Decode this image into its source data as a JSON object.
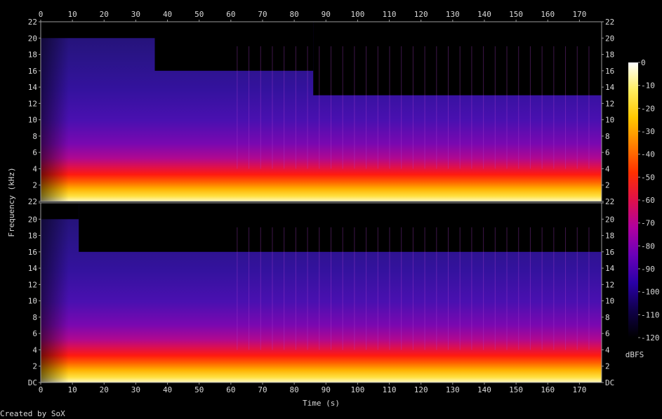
{
  "chart_data": {
    "type": "heatmap",
    "title": "",
    "xlabel": "Time (s)",
    "ylabel": "Frequency (kHz)",
    "xlim": [
      0,
      177
    ],
    "ylim": [
      0,
      22
    ],
    "x_ticks": [
      0,
      10,
      20,
      30,
      40,
      50,
      60,
      70,
      80,
      90,
      100,
      110,
      120,
      130,
      140,
      150,
      160,
      170
    ],
    "x_tick_labels": [
      "0",
      "10",
      "20",
      "30",
      "40",
      "50",
      "60",
      "70",
      "80",
      "90",
      "100",
      "110",
      "120",
      "130",
      "140",
      "150",
      "160",
      "170"
    ],
    "channels": [
      {
        "y_ticks": [
          0,
          2,
          4,
          6,
          8,
          10,
          12,
          14,
          16,
          18,
          20,
          22
        ],
        "y_tick_labels": [
          "",
          "2",
          "4",
          "6",
          "8",
          "10",
          "12",
          "14",
          "16",
          "18",
          "20",
          "22"
        ],
        "lowpass_khz": [
          {
            "t": [
              0,
              36
            ],
            "khz": 20
          },
          {
            "t": [
              36,
              86
            ],
            "khz": 16
          },
          {
            "t": [
              86,
              177
            ],
            "khz": 13
          }
        ]
      },
      {
        "y_ticks": [
          0,
          2,
          4,
          6,
          8,
          10,
          12,
          14,
          16,
          18,
          20,
          22
        ],
        "y_tick_labels": [
          "DC",
          "2",
          "4",
          "6",
          "8",
          "10",
          "12",
          "14",
          "16",
          "18",
          "20",
          "22"
        ],
        "lowpass_khz": [
          {
            "t": [
              0,
              12
            ],
            "khz": 20
          },
          {
            "t": [
              12,
              177
            ],
            "khz": 16
          }
        ]
      }
    ],
    "colorbar": {
      "label": "dBFS",
      "range": [
        -120,
        0
      ],
      "ticks": [
        0,
        -10,
        -20,
        -30,
        -40,
        -50,
        -60,
        -70,
        -80,
        -90,
        -100,
        -110,
        -120
      ],
      "tick_labels": [
        "0",
        "-10",
        "-20",
        "-30",
        "-40",
        "-50",
        "-60",
        "-70",
        "-80",
        "-90",
        "-100",
        "-110",
        "-120"
      ],
      "colors": [
        "#000000",
        "#10004a",
        "#2a00a8",
        "#6a00b8",
        "#b000a0",
        "#e0104a",
        "#ff3000",
        "#ff8000",
        "#ffc800",
        "#ffee60",
        "#ffffff"
      ]
    }
  },
  "footer": {
    "credit": "Created by SoX"
  }
}
